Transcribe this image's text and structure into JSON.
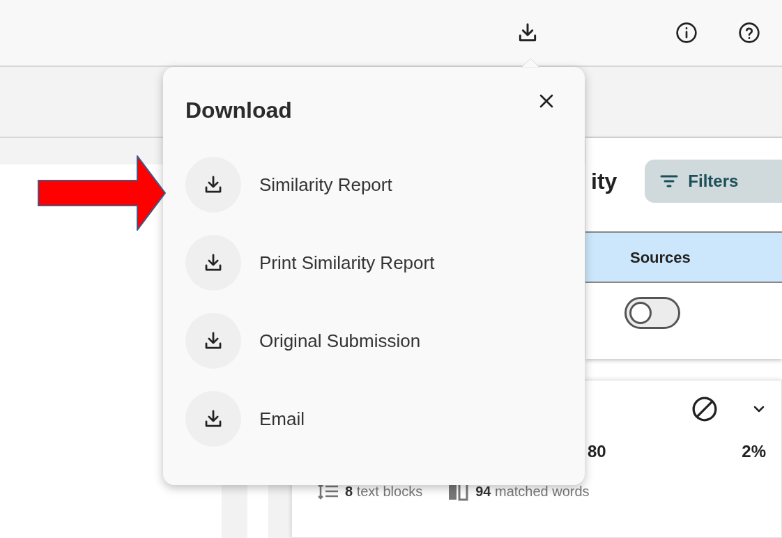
{
  "popover": {
    "title": "Download",
    "items": [
      {
        "label": "Similarity Report"
      },
      {
        "label": "Print Similarity Report"
      },
      {
        "label": "Original Submission"
      },
      {
        "label": "Email"
      }
    ]
  },
  "side_panel": {
    "title": "ity",
    "filters_button": "Filters",
    "tabs": [
      {
        "label": "Sources",
        "selected": true
      }
    ],
    "toggle": {
      "on": false
    }
  },
  "match_card": {
    "value": "80",
    "percent": "2%",
    "text_blocks": {
      "count": "8",
      "label": "text blocks"
    },
    "matched_words": {
      "count": "94",
      "label": "matched words"
    }
  }
}
